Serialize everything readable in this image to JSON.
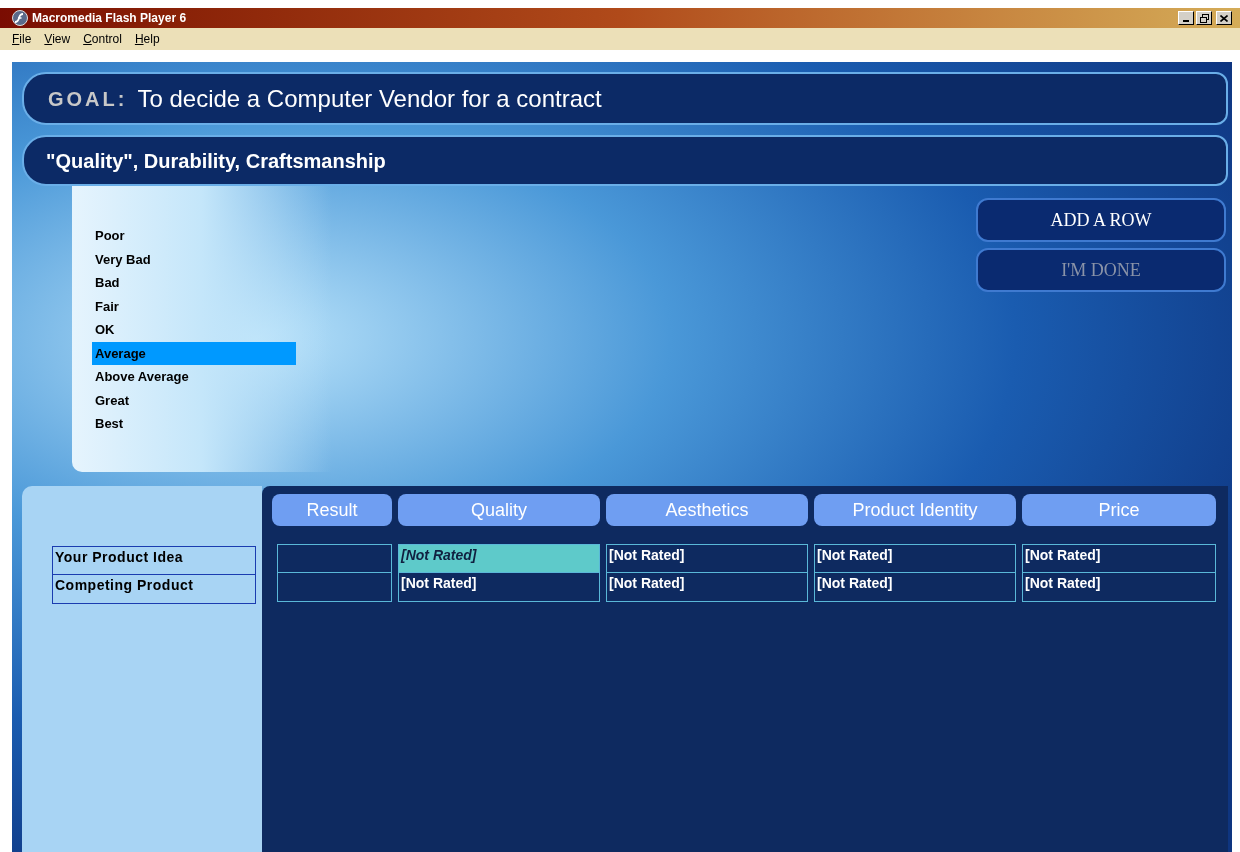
{
  "window": {
    "title": "Macromedia Flash Player 6"
  },
  "menu": [
    "File",
    "View",
    "Control",
    "Help"
  ],
  "goal": {
    "label": "GOAL:",
    "text": "To decide a Computer Vendor for a contract"
  },
  "criterion": "\"Quality\", Durability, Craftsmanship",
  "rating_options": [
    {
      "label": "Poor",
      "selected": false
    },
    {
      "label": "Very Bad",
      "selected": false
    },
    {
      "label": "Bad",
      "selected": false
    },
    {
      "label": "Fair",
      "selected": false
    },
    {
      "label": "OK",
      "selected": false
    },
    {
      "label": "Average",
      "selected": true
    },
    {
      "label": "Above Average",
      "selected": false
    },
    {
      "label": "Great",
      "selected": false
    },
    {
      "label": "Best",
      "selected": false
    }
  ],
  "buttons": [
    {
      "label": "ADD A ROW",
      "disabled": false
    },
    {
      "label": "I'M DONE",
      "disabled": true
    }
  ],
  "table": {
    "columns": [
      "Result",
      "Quality",
      "Aesthetics",
      "Product Identity",
      "Price"
    ],
    "rows": [
      {
        "label": "Your Product Idea",
        "cells": [
          {
            "selected": false
          },
          {
            "text": "[Not Rated]",
            "selected": true
          },
          {
            "text": "[Not Rated]",
            "selected": false
          },
          {
            "text": "[Not Rated]",
            "selected": false
          },
          {
            "text": "[Not Rated]",
            "selected": false
          }
        ]
      },
      {
        "label": "Competing Product",
        "cells": [
          {
            "selected": false
          },
          {
            "text": "[Not Rated]",
            "selected": false
          },
          {
            "text": "[Not Rated]",
            "selected": false
          },
          {
            "text": "[Not Rated]",
            "selected": false
          },
          {
            "text": "[Not Rated]",
            "selected": false
          }
        ]
      }
    ]
  }
}
